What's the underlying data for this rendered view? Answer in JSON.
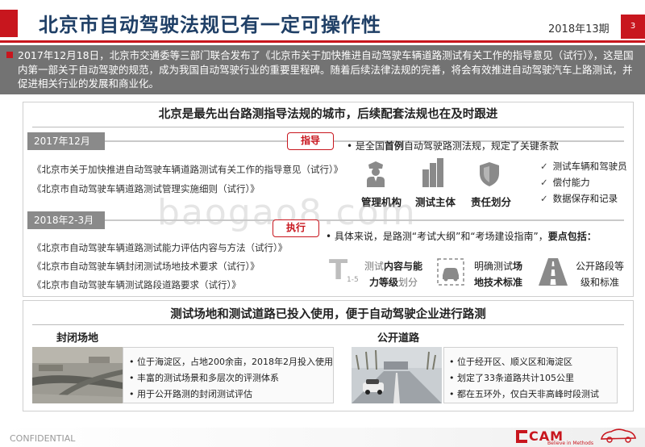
{
  "header": {
    "title": "北京市自动驾驶法规已有一定可操作性",
    "date": "2018年13期",
    "page": "3"
  },
  "intro": {
    "text": "2017年12月18日，北京市交通委等三部门联合发布了《北京市关于加快推进自动驾驶车辆道路测试有关工作的指导意见（试行）》，这是国内第一部关于自动驾驶的规范，成为我国自动驾驶行业的重要里程碑。随着后续法律法规的完善，将会有效推进自动驾驶汽车上路测试，并促进相关行业的发展和商业化。"
  },
  "section1": {
    "heading": "北京是最先出台路测指导法规的城市，后续配套法规也在及时跟进",
    "period1": {
      "label": "2017年12月",
      "tag": "指导",
      "docs": [
        "《北京市关于加快推进自动驾驶车辆道路测试有关工作的指导意见（试行）》",
        "《北京市自动驾驶车辆道路测试管理实施细则（试行）》"
      ],
      "point_pre": "• 是全国",
      "point_bold": "首例",
      "point_post": "自动驾驶路测法规，规定了关键条款",
      "icons": [
        {
          "icon": "police-officer-icon",
          "label": "管理机构"
        },
        {
          "icon": "buildings-icon",
          "label": "测试主体"
        },
        {
          "icon": "shield-icon",
          "label": "责任划分"
        }
      ],
      "checks": [
        "测试车辆和驾驶员",
        "偿付能力",
        "数据保存和记录"
      ]
    },
    "period2": {
      "label": "2018年2-3月",
      "tag": "执行",
      "docs": [
        "《北京市自动驾驶车辆道路测试能力评估内容与方法（试行）》",
        "《北京市自动驾驶车辆封闭测试场地技术要求（试行）》",
        "《北京市自动驾驶车辆测试路段道路要求（试行）》"
      ],
      "point_pre": "• 具体来说，是路测“考试大纲”和“考场建设指南”，",
      "point_bold": "要点包括：",
      "features": {
        "f1_icon_text": "T",
        "f1_sub": "1-5",
        "f1_line1_pre": "测试",
        "f1_line1_bold": "内容与能",
        "f1_line2_bold": "力等级",
        "f1_line2_post": "划分",
        "f2_line1_pre": "明确测试",
        "f2_line1_bold": "场",
        "f2_line2_bold": "地技术标准",
        "f3_line1": "公开路段等",
        "f3_line2": "级和标准"
      }
    }
  },
  "section2": {
    "heading": "测试场地和测试道路已投入使用，便于自动驾驶企业进行路测",
    "closed": {
      "title": "封闭场地",
      "items": [
        "• 位于海淀区，占地200余亩，2018年2月投入使用",
        "• 丰富的测试场景和多层次的评测体系",
        "• 用于公开路测的封闭测试评估"
      ]
    },
    "open": {
      "title": "公开道路",
      "items": [
        "• 位于经开区、顺义区和海淀区",
        "• 划定了33条道路共计105公里",
        "• 都在五环外，仅白天非高峰时段测试"
      ]
    }
  },
  "footer": {
    "confidential": "CONFIDENTIAL",
    "logo": "CAM",
    "logo_sub": "Believe in Methods"
  },
  "watermark": "baogao8.com",
  "colors": {
    "accent": "#c8161e",
    "title": "#1f3f66",
    "intro_bg": "#737373",
    "period_bg": "#8a8a8a"
  }
}
